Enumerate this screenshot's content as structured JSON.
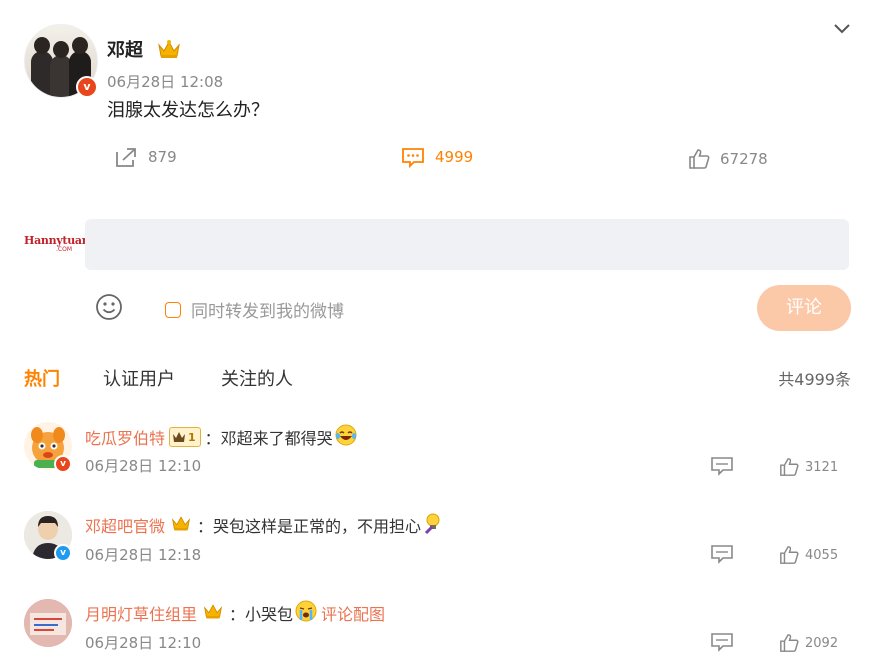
{
  "post": {
    "author": "邓超",
    "time": "06月28日 12:08",
    "text": "泪腺太发达怎么办？",
    "verified_mark": "v",
    "actions": {
      "repost_count": "879",
      "comment_count": "4999",
      "like_count": "67278"
    }
  },
  "composer": {
    "brand_logo_text": "Hannytuan",
    "brand_logo_sub": ".COM",
    "input_value": "",
    "repost_label": "同时转发到我的微博",
    "submit_label": "评论"
  },
  "tabs": {
    "hot": "热门",
    "verified_users": "认证用户",
    "following": "关注的人",
    "total": "共4999条"
  },
  "comments": [
    {
      "name": "吃瓜罗伯特",
      "level": "1",
      "text": "：邓超来了都得哭",
      "time": "06月28日 12:10",
      "likes": "3121"
    },
    {
      "name": "邓超吧官微",
      "text": "：哭包这样是正常的，不用担心",
      "time": "06月28日 12:18",
      "likes": "4055"
    },
    {
      "name": "月明灯草住组里",
      "text": "：小哭包",
      "image_link": "评论配图",
      "time": "06月28日 12:10",
      "likes": "2092"
    }
  ],
  "colors": {
    "accent": "#ff8200",
    "name_link": "#eb7350",
    "submit_bg": "#fbc8a8",
    "input_bg": "#f0f1f5",
    "verified_orange": "#e8461c",
    "verified_blue": "#1e9bf0"
  },
  "icons": {
    "collapse": "chevron-down-icon",
    "repost": "share-arrow-icon",
    "comment": "comment-bubble-icon",
    "like": "thumbs-up-icon",
    "emoji": "smiley-icon",
    "crown": "crown-icon"
  }
}
